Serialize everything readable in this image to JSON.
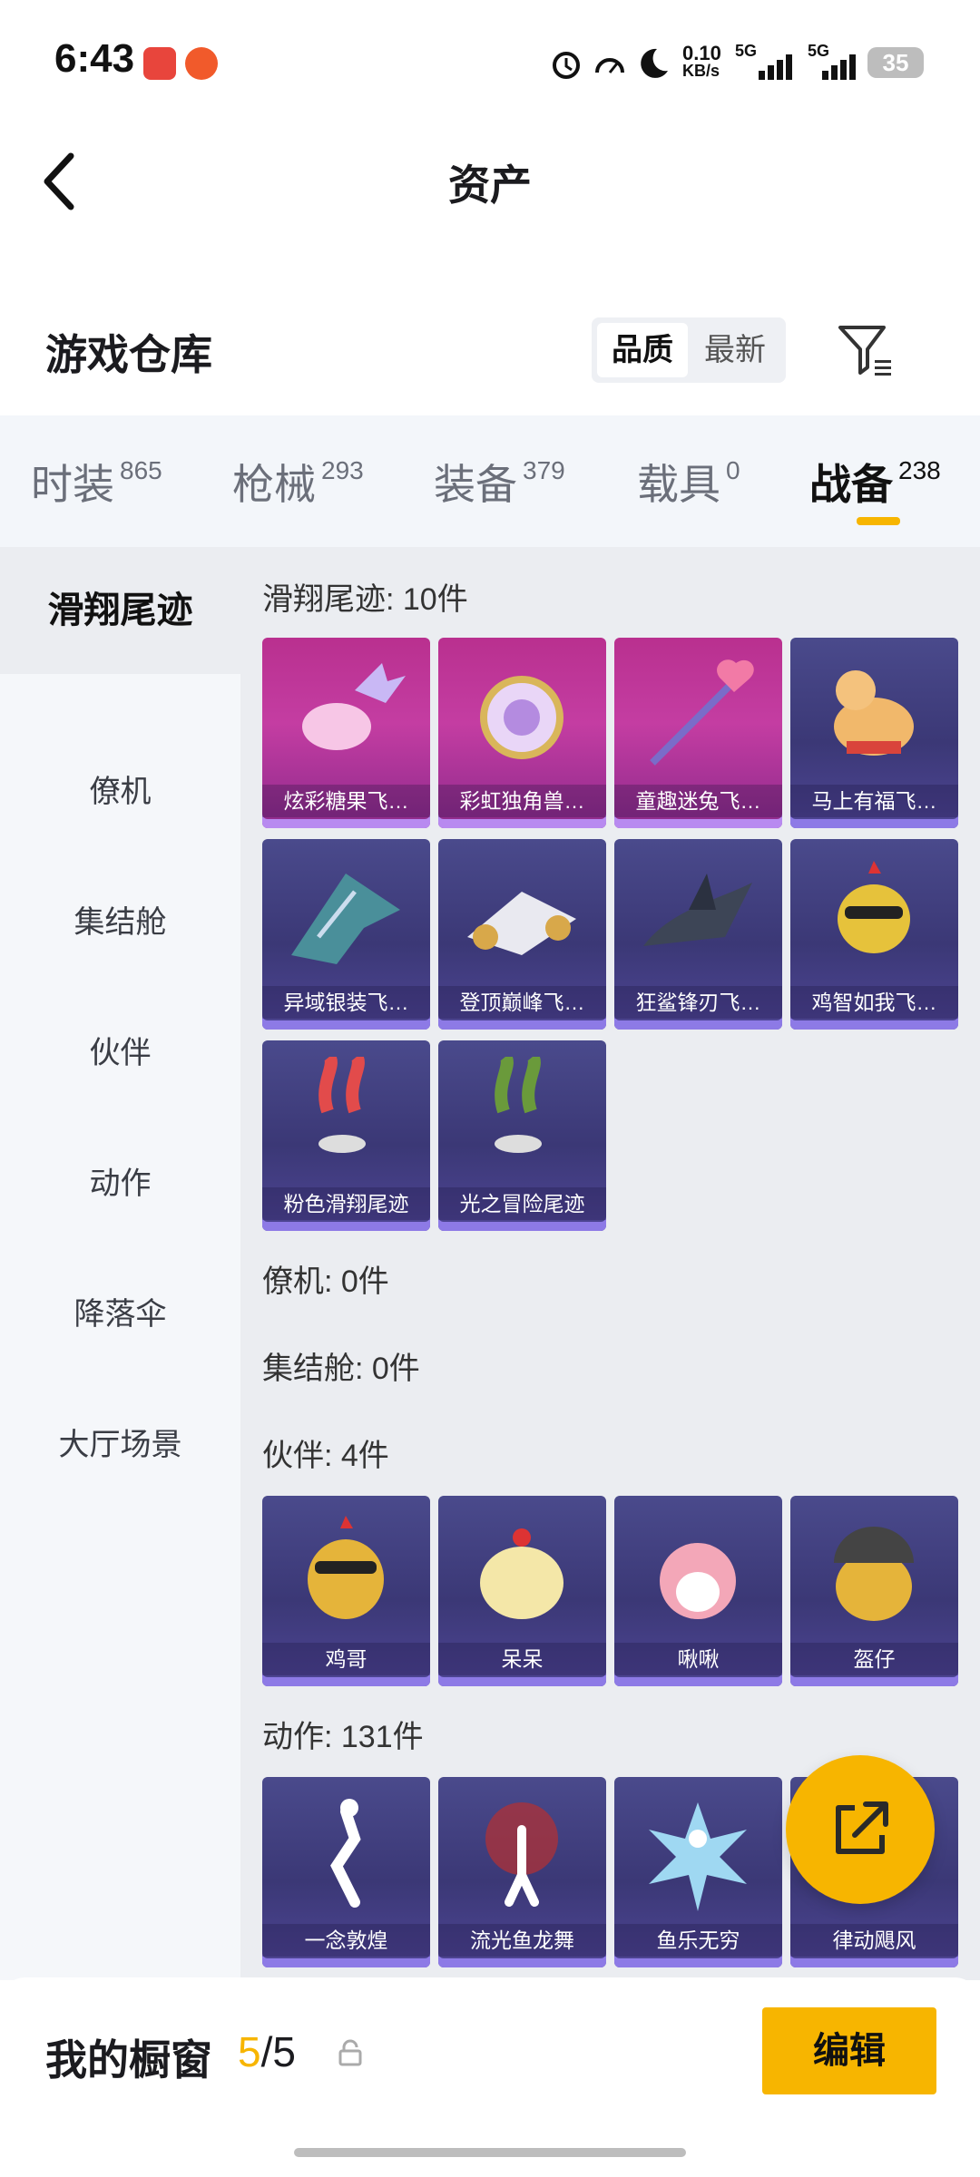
{
  "status": {
    "time": "6:43",
    "net_speed": "0.10",
    "net_unit": "KB/s",
    "sig1": "5G",
    "sig2": "5G",
    "battery": "35"
  },
  "header": {
    "title": "资产"
  },
  "warehouse": {
    "title": "游戏仓库",
    "sort_quality": "品质",
    "sort_latest": "最新"
  },
  "tabs": [
    {
      "label": "时装",
      "count": "865"
    },
    {
      "label": "枪械",
      "count": "293"
    },
    {
      "label": "装备",
      "count": "379"
    },
    {
      "label": "载具",
      "count": "0"
    },
    {
      "label": "战备",
      "count": "238"
    }
  ],
  "sidebar": [
    "滑翔尾迹",
    "僚机",
    "集结舱",
    "伙伴",
    "动作",
    "降落伞",
    "大厅场景"
  ],
  "sections": {
    "glide": {
      "title": "滑翔尾迹: 10件",
      "items": [
        "炫彩糖果飞…",
        "彩虹独角兽…",
        "童趣迷兔飞…",
        "马上有福飞…",
        "异域银装飞…",
        "登顶巅峰飞…",
        "狂鲨锋刃飞…",
        "鸡智如我飞…",
        "粉色滑翔尾迹",
        "光之冒险尾迹"
      ]
    },
    "wingman": {
      "title": "僚机: 0件"
    },
    "pod": {
      "title": "集结舱: 0件"
    },
    "partner": {
      "title": "伙伴: 4件",
      "items": [
        "鸡哥",
        "呆呆",
        "啾啾",
        "盔仔"
      ]
    },
    "emote": {
      "title": "动作: 131件",
      "items": [
        "一念敦煌",
        "流光鱼龙舞",
        "鱼乐无穷",
        "律动飓风"
      ]
    }
  },
  "bottom": {
    "label": "我的橱窗",
    "count_current": "5",
    "count_total": "/5",
    "edit": "编辑"
  },
  "colors": {
    "accent": "#f7b500",
    "card_epic": "#3b3876",
    "card_legend": "#c43da2"
  }
}
